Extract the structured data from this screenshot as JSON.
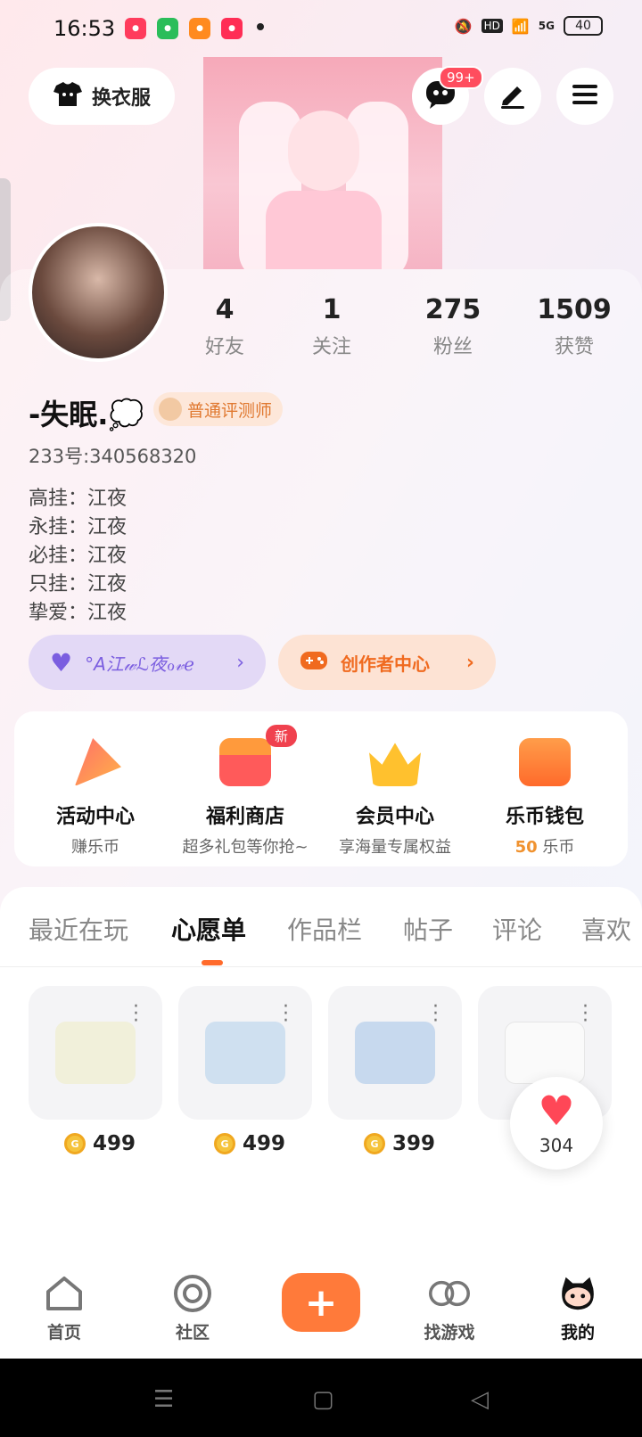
{
  "status_bar": {
    "time": "16:53",
    "battery": "40",
    "hd": "HD",
    "signal": "5G"
  },
  "top": {
    "outfit_label": "换衣服",
    "notification_badge": "99+"
  },
  "stats": [
    {
      "value": "4",
      "label": "好友"
    },
    {
      "value": "1",
      "label": "关注"
    },
    {
      "value": "275",
      "label": "粉丝"
    },
    {
      "value": "1509",
      "label": "获赞"
    }
  ],
  "profile": {
    "username": "-失眠.💭",
    "title_badge": "普通评测师",
    "uid": "233号:340568320",
    "bio": [
      "高挂：江夜",
      "永挂：江夜",
      "必挂：江夜",
      "只挂：江夜",
      "挚爱：江夜"
    ]
  },
  "pills": {
    "couple": "°A江𝓌ℒ夜ℴ𝓋ℯ",
    "creator": "创作者中心"
  },
  "services": [
    {
      "name": "活动中心",
      "desc": "赚乐币"
    },
    {
      "name": "福利商店",
      "desc": "超多礼包等你抢~",
      "badge": "新"
    },
    {
      "name": "会员中心",
      "desc": "享海量专属权益"
    },
    {
      "name": "乐币钱包",
      "desc_value": "50",
      "desc_unit": "乐币"
    }
  ],
  "tabs": [
    "最近在玩",
    "心愿单",
    "作品栏",
    "帖子",
    "评论",
    "喜欢"
  ],
  "active_tab": "心愿单",
  "wishlist": [
    {
      "price": "499",
      "color": "#f1f0da"
    },
    {
      "price": "499",
      "color": "#cfe0f0"
    },
    {
      "price": "399",
      "color": "#c7d9ee"
    },
    {
      "price": "",
      "color": "#f7f7f7"
    }
  ],
  "like_count": "304",
  "bottom_nav": [
    {
      "label": "首页",
      "icon": "home-icon"
    },
    {
      "label": "社区",
      "icon": "community-icon"
    },
    {
      "label": "找游戏",
      "icon": "find-game-icon"
    },
    {
      "label": "我的",
      "icon": "profile-icon"
    }
  ],
  "colors": {
    "accent": "#ff7a3a",
    "purple": "#7b5ee0",
    "coin": "#f5c33b"
  }
}
